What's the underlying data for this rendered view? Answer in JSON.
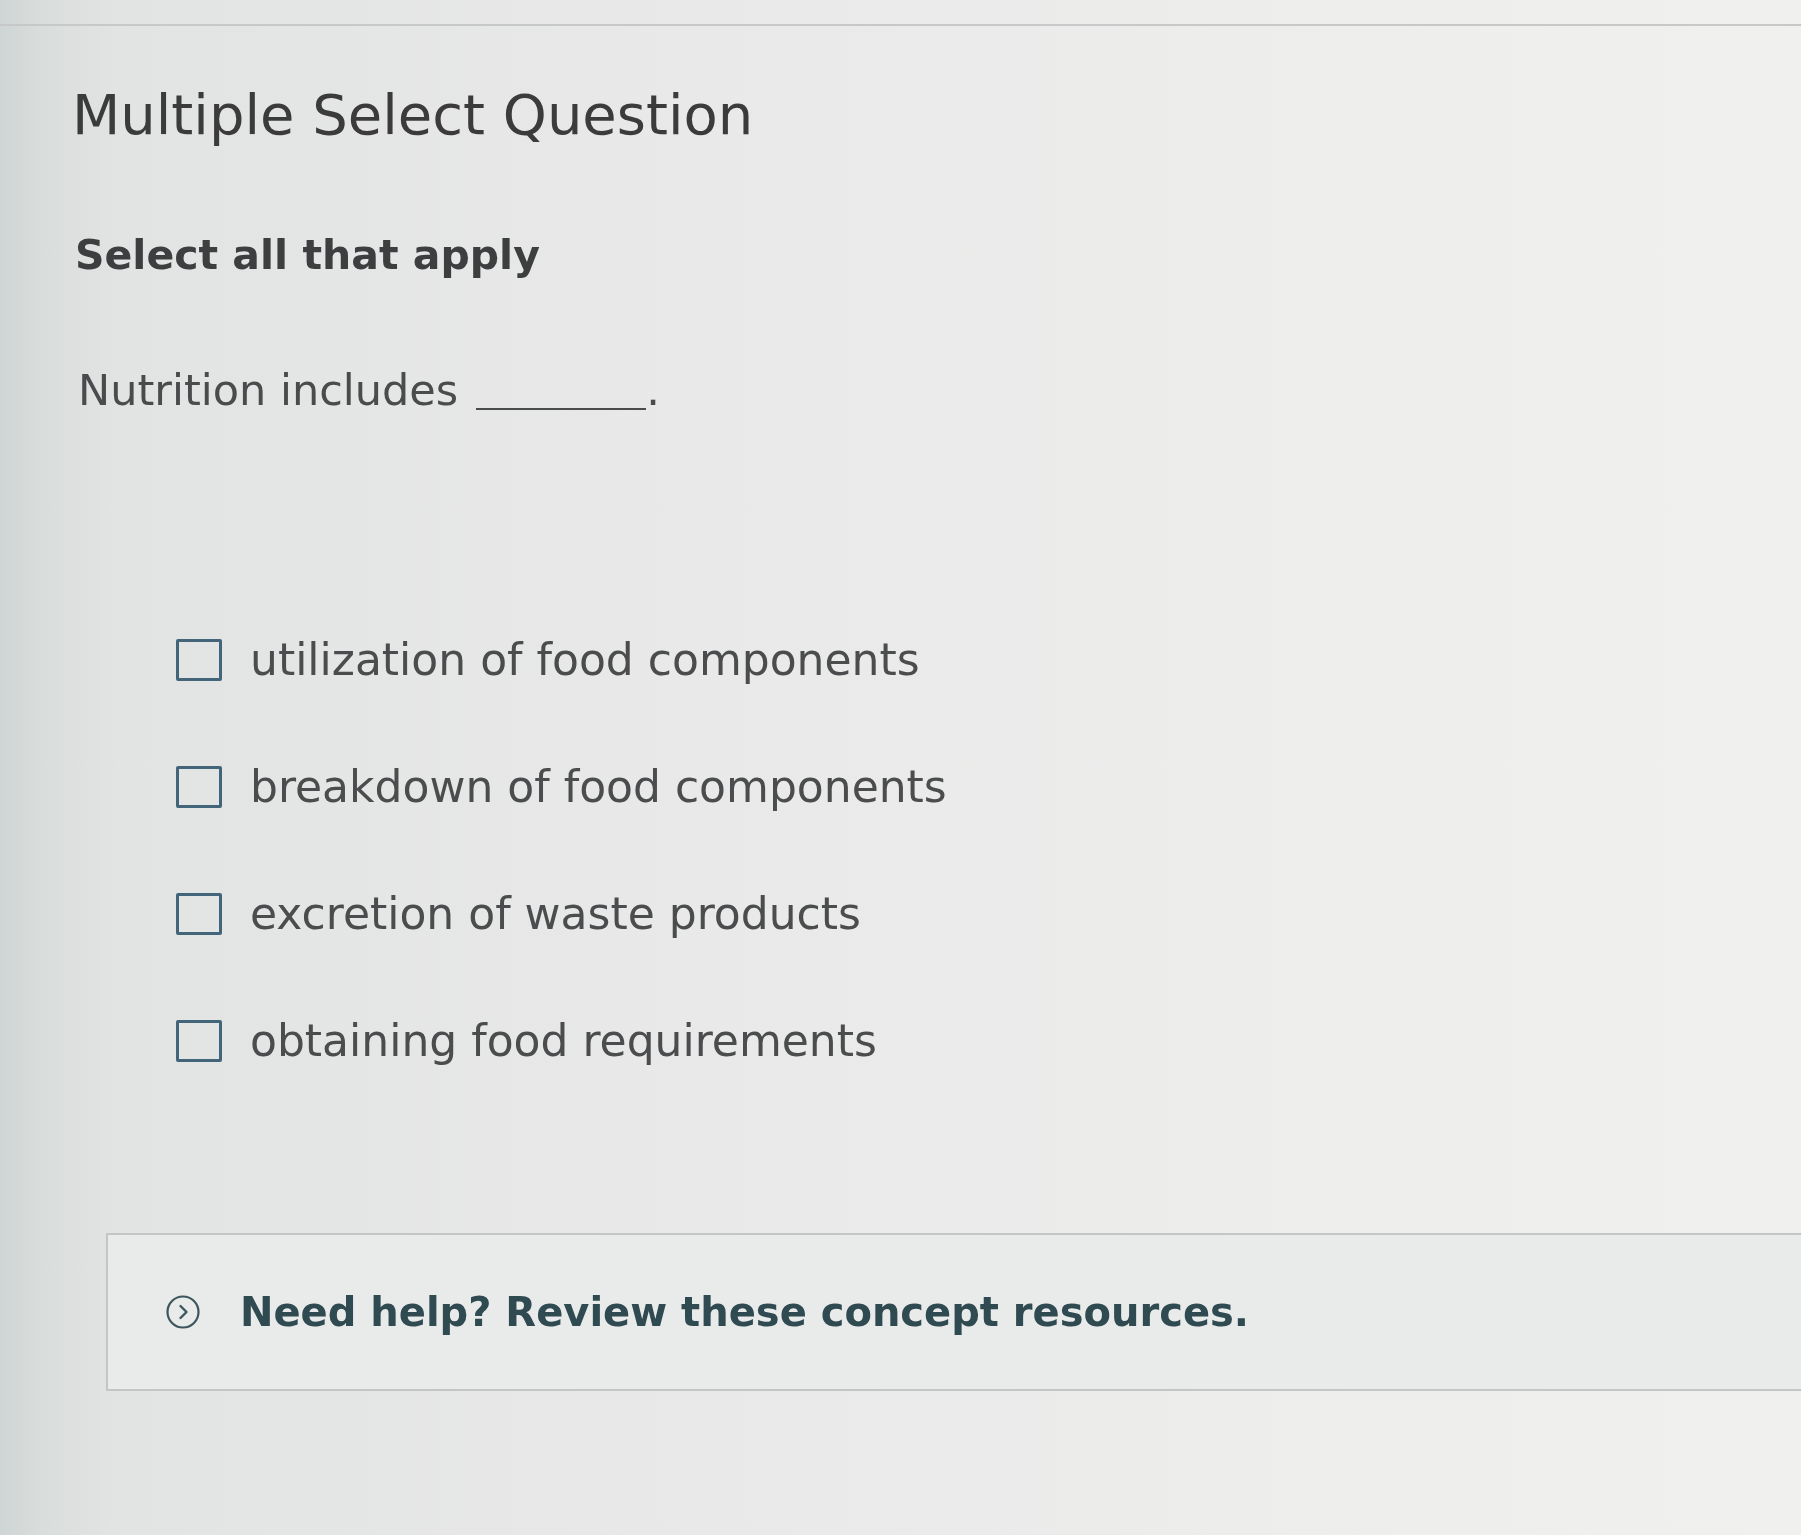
{
  "header": {
    "title": "Multiple Select Question"
  },
  "instruction": "Select all that apply",
  "question": {
    "prompt": "Nutrition includes",
    "ending": "."
  },
  "options": [
    {
      "label": "utilization of food components",
      "checked": false
    },
    {
      "label": "breakdown of food components",
      "checked": false
    },
    {
      "label": "excretion of waste products",
      "checked": false
    },
    {
      "label": "obtaining food requirements",
      "checked": false
    }
  ],
  "help": {
    "text": "Need help? Review these concept resources.",
    "expanded": false
  }
}
